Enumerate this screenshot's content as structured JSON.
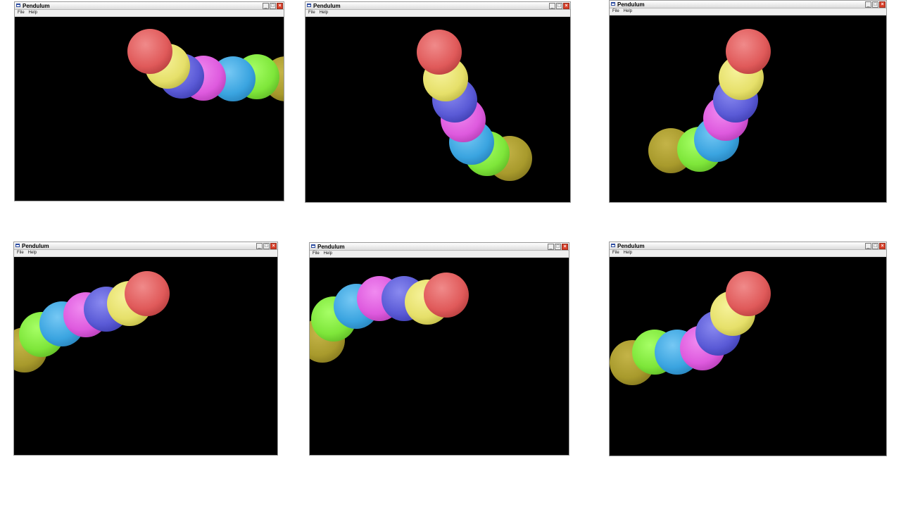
{
  "app": {
    "title": "Pendulum"
  },
  "menu": {
    "file": "File",
    "help": "Help"
  },
  "buttons": {
    "minimize": "_",
    "maximize": "□",
    "close": "×"
  },
  "ball_colors": [
    "#e05a5a",
    "#e6e06a",
    "#5a5ad6",
    "#de5ade",
    "#3aa4e0",
    "#7ee63a",
    "#a89a2c"
  ],
  "ball_order": [
    "red",
    "yellow",
    "blue",
    "magenta",
    "cyan",
    "green",
    "olive"
  ]
}
